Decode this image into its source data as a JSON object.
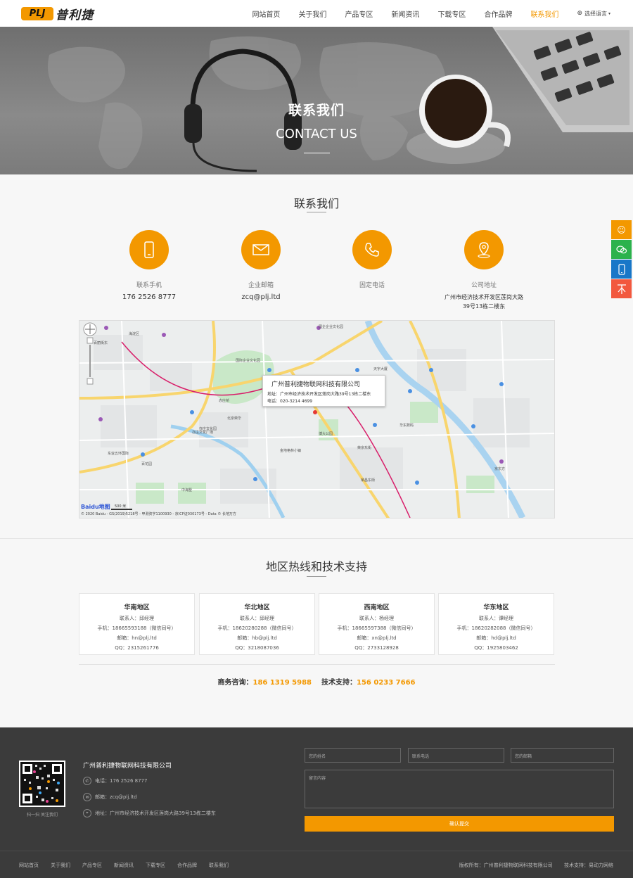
{
  "header": {
    "logo_badge": "PLJ",
    "logo_text": "普利捷",
    "nav": [
      "网站首页",
      "关于我们",
      "产品专区",
      "新闻资讯",
      "下载专区",
      "合作品牌",
      "联系我们"
    ],
    "active": "联系我们",
    "lang": "选择语言"
  },
  "banner": {
    "title": "联系我们",
    "subtitle": "CONTACT US"
  },
  "contact": {
    "title": "联系我们",
    "items": [
      {
        "label": "联系手机",
        "value": "176 2526 8777",
        "icon": "mobile-icon"
      },
      {
        "label": "企业邮箱",
        "value": "zcq@plj.ltd",
        "icon": "mail-icon"
      },
      {
        "label": "固定电话",
        "value": "",
        "icon": "phone-icon"
      },
      {
        "label": "公司地址",
        "value": "广州市经济技术开发区莲岗大路39号13栋二楼东",
        "icon": "location-icon"
      }
    ]
  },
  "map": {
    "popup_title": "广州普利捷物联网科技有限公司",
    "popup_address": "地址：广州市经济技术开发区莲岗大路39号13栋二楼东",
    "popup_phone": "电话：020-3214 4699",
    "logo": "Baidu地图",
    "scale": "500 米",
    "copyright": "© 2020 Baidu - GS(2019)5218号 - 甲测资字1100930 - 京ICP证030173号 - Data © 长地万方",
    "labels": [
      "国企企业文化园",
      "国际企业文化园",
      "赤庄桥",
      "亦庄文化园",
      "天宇大厦",
      "北京荣华",
      "金地格林小镇",
      "博大公园",
      "荣京东街",
      "荣昌东街",
      "亦庄文化广场",
      "中海墅",
      "京东方",
      "华东数码",
      "海淀区",
      "百花园",
      "东亚五环国际",
      "百丽街东"
    ]
  },
  "regions": {
    "title": "地区热线和技术支持",
    "items": [
      {
        "name": "华南地区",
        "contact": "联系人：邱经理",
        "mobile": "手机：18665593188（微信同号）",
        "email": "邮箱：hn@plj.ltd",
        "qq": "QQ：2315261776"
      },
      {
        "name": "华北地区",
        "contact": "联系人：邱经理",
        "mobile": "手机：18620280288（微信同号）",
        "email": "邮箱：hb@plj.ltd",
        "qq": "QQ：3218087036"
      },
      {
        "name": "西南地区",
        "contact": "联系人：杨经理",
        "mobile": "手机：18665597388（微信同号）",
        "email": "邮箱：xn@plj.ltd",
        "qq": "QQ：2733128928"
      },
      {
        "name": "华东地区",
        "contact": "联系人：谭经理",
        "mobile": "手机：18620282088（微信同号）",
        "email": "邮箱：hd@plj.ltd",
        "qq": "QQ：1925803462"
      }
    ],
    "business_label": "商务咨询：",
    "business_number": "186 1319 5988",
    "tech_label": "技术支持：",
    "tech_number": "156 0233 7666"
  },
  "footer": {
    "qr_caption": "扫一扫 关注我们",
    "company": "广州普利捷物联网科技有限公司",
    "phone": "电话：176 2526 8777",
    "email": "邮箱：zcq@plj.ltd",
    "address": "地址：广州市经济技术开发区莲岗大路39号13栋二楼东",
    "form": {
      "name_placeholder": "您的姓名",
      "phone_placeholder": "联系电话",
      "email_placeholder": "您的邮箱",
      "message_placeholder": "留言内容",
      "submit": "确认提交"
    },
    "nav": [
      "网站首页",
      "关于我们",
      "产品专区",
      "新闻资讯",
      "下载专区",
      "合作品牌",
      "联系我们"
    ],
    "copyright": "版权所有：广州普利捷物联网科技有限公司",
    "tech": "技术支持：易动力网络"
  },
  "side_tools": [
    "smile-icon",
    "wechat-icon",
    "mobile-icon",
    "top-icon"
  ],
  "colors": {
    "accent": "#f39800",
    "footer_bg": "#3b3b3b",
    "side_green": "#2bb24c",
    "side_blue": "#1877c8",
    "side_red": "#f2583e"
  }
}
